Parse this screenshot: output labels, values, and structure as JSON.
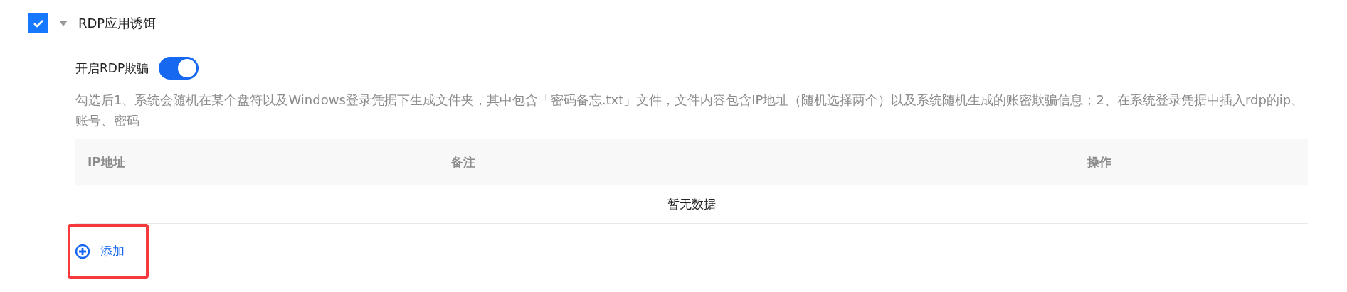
{
  "section": {
    "title": "RDP应用诱饵",
    "checked": true,
    "expanded": true
  },
  "switch_row": {
    "label": "开启RDP欺骗",
    "on": true
  },
  "description": "勾选后1、系统会随机在某个盘符以及Windows登录凭据下生成文件夹，其中包含「密码备忘.txt」文件，文件内容包含IP地址（随机选择两个）以及系统随机生成的账密欺骗信息；2、在系统登录凭据中插入rdp的ip、账号、密码",
  "table": {
    "columns": [
      "IP地址",
      "备注",
      "操作"
    ],
    "empty_text": "暂无数据"
  },
  "add_button": {
    "label": "添加",
    "highlighted": true
  }
}
